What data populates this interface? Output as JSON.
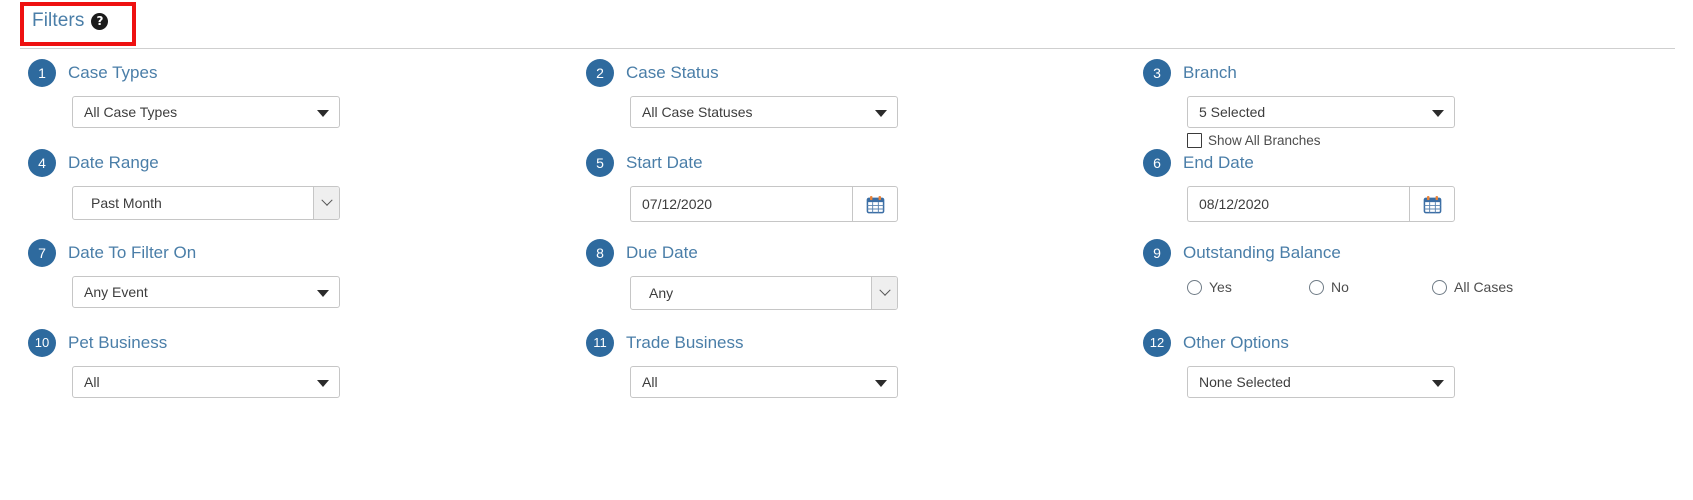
{
  "header": {
    "title": "Filters",
    "help_icon": "question-mark-circle-icon",
    "highlight_color": "#ee1111"
  },
  "theme": {
    "badge_bg": "#2E6A9E",
    "label_color": "#4A7EA8",
    "border": "#c6c6c6"
  },
  "filters": [
    {
      "number": "1",
      "label": "Case Types",
      "control": "dropdown",
      "value": "All Case Types"
    },
    {
      "number": "2",
      "label": "Case Status",
      "control": "dropdown",
      "value": "All Case Statuses"
    },
    {
      "number": "3",
      "label": "Branch",
      "control": "dropdown",
      "value": "5 Selected",
      "checkbox_label": "Show All Branches",
      "checkbox_checked": false
    },
    {
      "number": "4",
      "label": "Date Range",
      "control": "select",
      "value": "Past Month"
    },
    {
      "number": "5",
      "label": "Start Date",
      "control": "date",
      "value": "07/12/2020",
      "button_icon": "calendar-icon"
    },
    {
      "number": "6",
      "label": "End Date",
      "control": "date",
      "value": "08/12/2020",
      "button_icon": "calendar-icon"
    },
    {
      "number": "7",
      "label": "Date To Filter On",
      "control": "dropdown",
      "value": "Any Event"
    },
    {
      "number": "8",
      "label": "Due Date",
      "control": "select",
      "value": "Any"
    },
    {
      "number": "9",
      "label": "Outstanding Balance",
      "control": "radios",
      "options": [
        {
          "label": "Yes",
          "selected": false
        },
        {
          "label": "No",
          "selected": false
        },
        {
          "label": "All Cases",
          "selected": false
        }
      ]
    },
    {
      "number": "10",
      "label": "Pet Business",
      "control": "dropdown",
      "value": "All"
    },
    {
      "number": "11",
      "label": "Trade Business",
      "control": "dropdown",
      "value": "All"
    },
    {
      "number": "12",
      "label": "Other Options",
      "control": "dropdown",
      "value": "None Selected"
    }
  ]
}
